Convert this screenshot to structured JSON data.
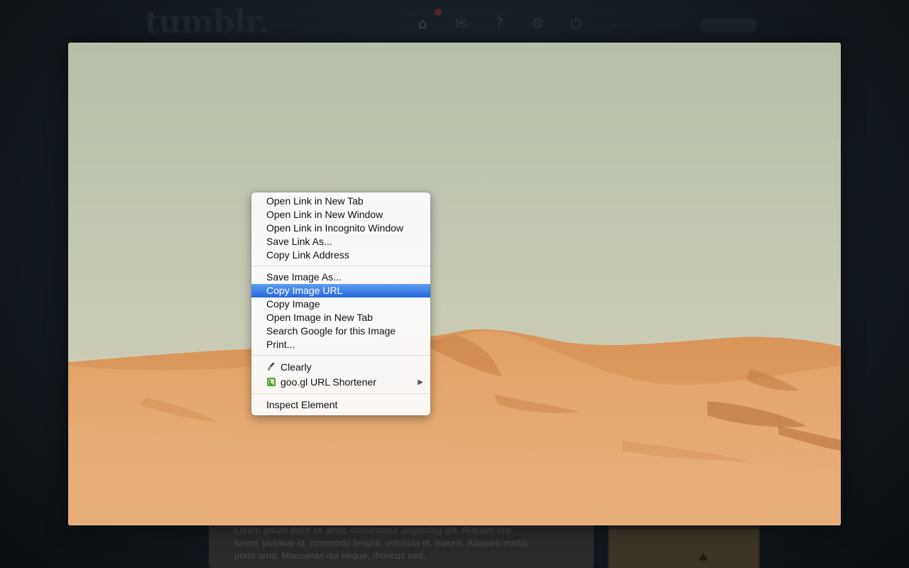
{
  "dashboard": {
    "logo": "tumblr.",
    "nav_icons": [
      "home-icon",
      "mail-icon",
      "help-icon",
      "gear-icon",
      "power-icon"
    ],
    "post_text": "Lorem ipsum dolor sit amet, consectetur adipiscing elit. Aliquam nisi lorem, pulvinar id, commodo feugiat, vehicula et, mauris. Aliquam mattis porta urna. Maecenas dui neque, rhoncus sed,"
  },
  "context_menu": {
    "groups": [
      {
        "items": [
          {
            "label": "Open Link in New Tab"
          },
          {
            "label": "Open Link in New Window"
          },
          {
            "label": "Open Link in Incognito Window"
          },
          {
            "label": "Save Link As..."
          },
          {
            "label": "Copy Link Address"
          }
        ]
      },
      {
        "items": [
          {
            "label": "Save Image As..."
          },
          {
            "label": "Copy Image URL",
            "highlighted": true
          },
          {
            "label": "Copy Image"
          },
          {
            "label": "Open Image in New Tab"
          },
          {
            "label": "Search Google for this Image"
          },
          {
            "label": "Print..."
          }
        ]
      },
      {
        "items": [
          {
            "label": "Clearly",
            "icon": "clearly-icon"
          },
          {
            "label": "goo.gl URL Shortener",
            "icon": "goo-gl-icon",
            "submenu_arrow": "▶"
          }
        ]
      },
      {
        "items": [
          {
            "label": "Inspect Element"
          }
        ]
      }
    ]
  },
  "colors": {
    "highlight_top": "#5c9cf1",
    "highlight_bottom": "#2867de",
    "sky": "#c2c8b4",
    "sand": "#e2a066"
  }
}
